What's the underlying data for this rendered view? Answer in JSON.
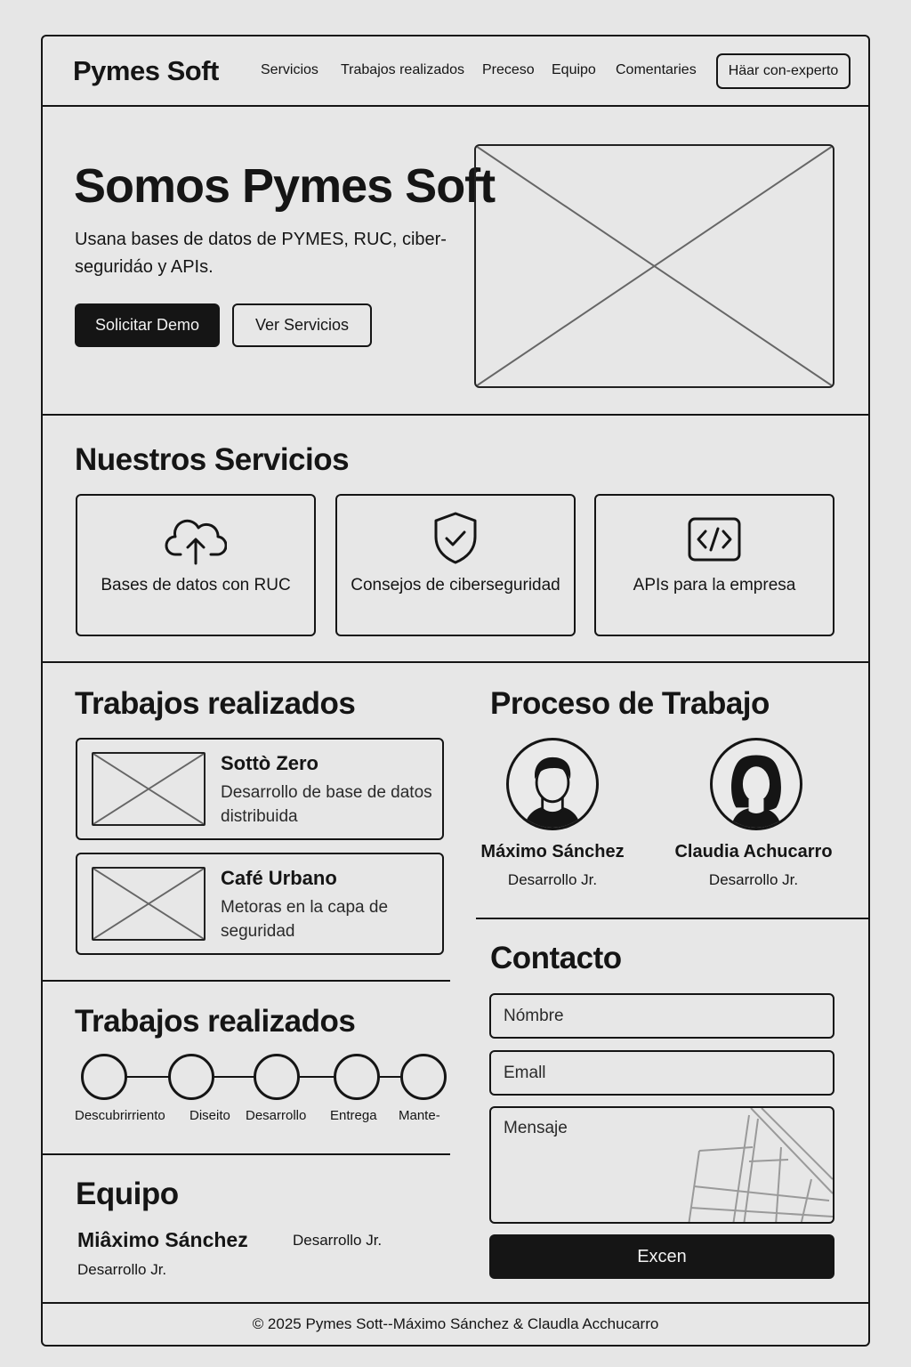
{
  "header": {
    "brand": "Pymes Soft",
    "nav": [
      "Servicios",
      "Trabajos realizados",
      "Preceso",
      "Equipo",
      "Comentaries"
    ],
    "cta": "Häar con-experto"
  },
  "hero": {
    "title": "Somos Pymes Soft",
    "subtitle": "Usana bases de datos de PYMES, RUC, ciber-seguridáo y APIs.",
    "primary_button": "Solicitar Demo",
    "secondary_button": "Ver Servicios",
    "image_icon": "image-placeholder-icon"
  },
  "services": {
    "title": "Nuestros Servicios",
    "items": [
      {
        "label": "Bases de datos con RUC",
        "icon": "cloud-upload-icon"
      },
      {
        "label": "Consejos de ciberseguridad",
        "icon": "shield-check-icon"
      },
      {
        "label": "APIs para la empresa",
        "icon": "code-icon"
      }
    ]
  },
  "works": {
    "title": "Trabajos realizados",
    "items": [
      {
        "title": "Sottò Zero",
        "description": "Desarrollo de base de datos distribuida"
      },
      {
        "title": "Café Urbano",
        "description": "Metoras en la capa de seguridad"
      }
    ]
  },
  "process": {
    "title": "Proceso de Trabajo",
    "people": [
      {
        "name": "Máximo Sánchez",
        "role": "Desarrollo Jr.",
        "icon": "male-avatar-icon"
      },
      {
        "name": "Claudia Achucarro",
        "role": "Desarrollo Jr.",
        "icon": "female-avatar-icon"
      }
    ]
  },
  "timeline": {
    "title": "Trabajos realizados",
    "steps": [
      "Descubrirriento",
      "Diseito",
      "Desarrollo",
      "Entrega",
      "Mante-"
    ]
  },
  "team": {
    "title": "Equipo",
    "name": "Miâximo Sánchez",
    "role": "Desarrollo Jr.",
    "role_right": "Desarrollo Jr."
  },
  "contact": {
    "title": "Contacto",
    "name_placeholder": "Nómbre",
    "email_placeholder": "Emall",
    "message_placeholder": "Mensaje",
    "submit": "Excen",
    "map_icon": "map-icon"
  },
  "footer": {
    "text": "© 2025 Pymes Sott--Máximo Sánchez & Claudla Acchucarro"
  }
}
